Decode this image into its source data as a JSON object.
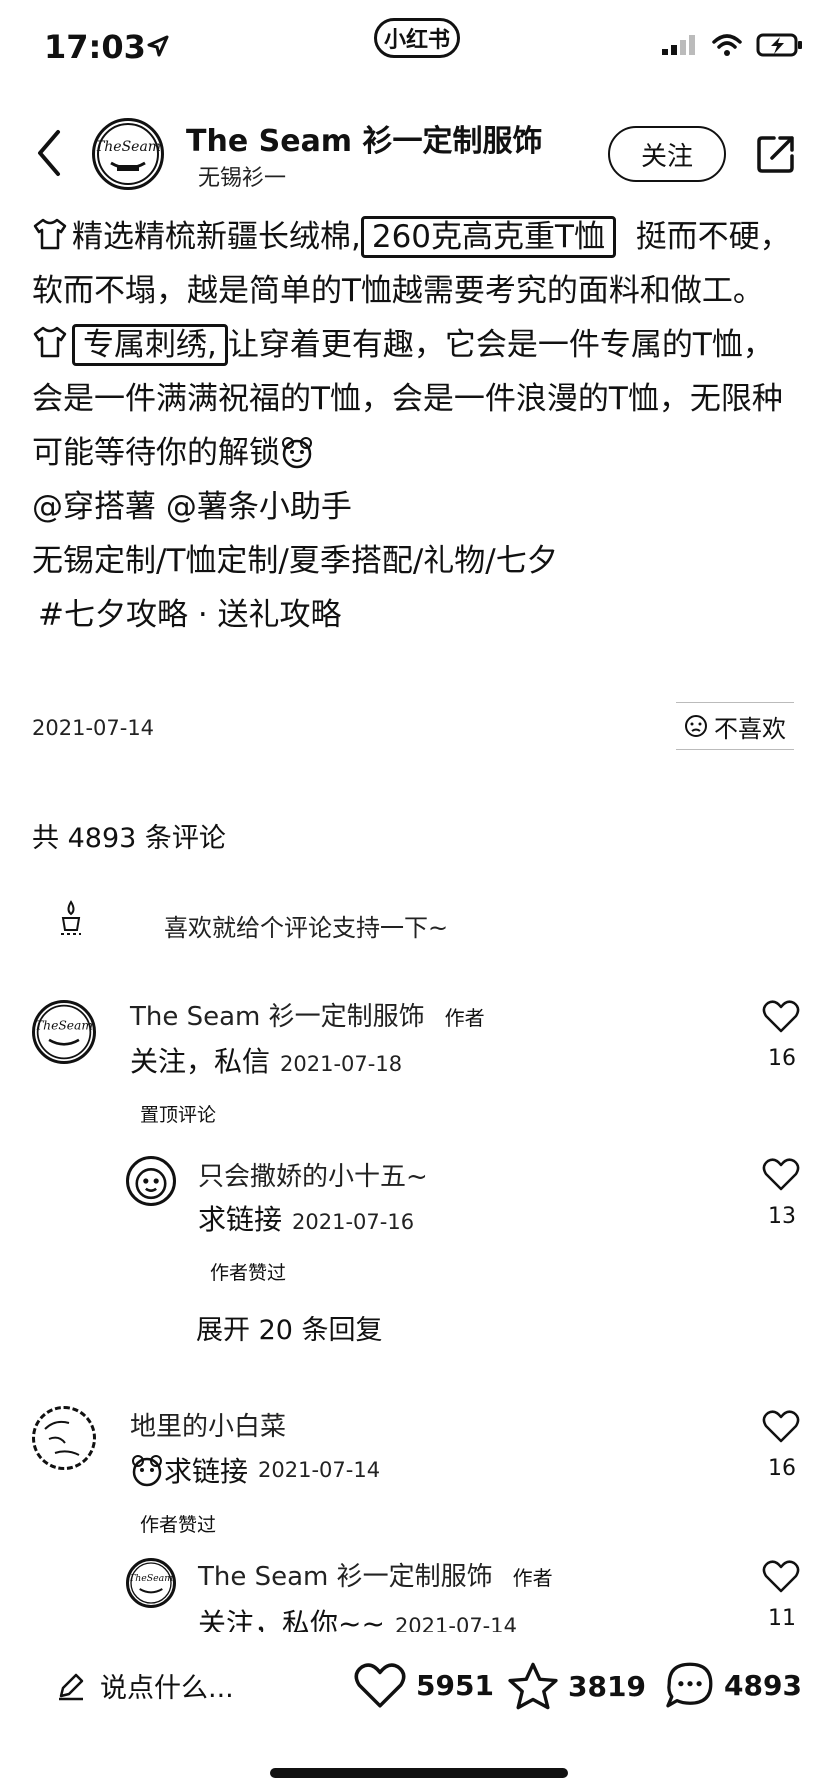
{
  "status": {
    "time": "17:03",
    "app_badge": "小红书"
  },
  "header": {
    "author_name": "The Seam 衫一定制服饰",
    "location": "无锡衫一",
    "follow_label": "关注"
  },
  "post": {
    "seg1": "精选精梳新疆长绒棉,",
    "box1": "260克高克重T恤",
    "seg2": "挺而不硬，软而不塌，越是简单的T恤越需要考究的面料和做工。",
    "box2": "专属刺绣,",
    "seg3": "让穿着更有趣，它会是一件专属的T恤，会是一件满满祝福的T恤，会是一件浪漫的T恤，无限种可能等待你的解锁",
    "mentions": "@穿搭薯 @薯条小助手",
    "tags": "无锡定制/T恤定制/夏季搭配/礼物/七夕",
    "hashtags": "#七夕攻略 · 送礼攻略",
    "date": "2021-07-14",
    "dislike_label": "不喜欢"
  },
  "comments_section": {
    "count_label": "共 4893 条评论",
    "prompt": "喜欢就给个评论支持一下~"
  },
  "comments": [
    {
      "name": "The Seam 衫一定制服饰",
      "tag": "作者",
      "text": "关注，私信",
      "date": "2021-07-18",
      "likes": "16",
      "badge": "置顶评论"
    },
    {
      "name": "只会撒娇的小十五~",
      "text": "求链接",
      "date": "2021-07-16",
      "likes": "13",
      "badge": "作者赞过",
      "expand": "展开 20 条回复"
    },
    {
      "name": "地里的小白菜",
      "text": "求链接",
      "date": "2021-07-14",
      "likes": "16",
      "badge": "作者赞过"
    },
    {
      "name": "The Seam 衫一定制服饰",
      "tag": "作者",
      "text": "关注，私你~~",
      "date": "2021-07-14",
      "likes": "11"
    }
  ],
  "bottom_bar": {
    "input_placeholder": "说点什么...",
    "likes": "5951",
    "stars": "3819",
    "comments": "4893"
  },
  "icons": {
    "back": "chevron-left-icon",
    "share": "share-icon",
    "heart": "heart-icon",
    "star": "star-icon",
    "comment": "comment-bubble-icon",
    "pencil": "pencil-icon"
  }
}
